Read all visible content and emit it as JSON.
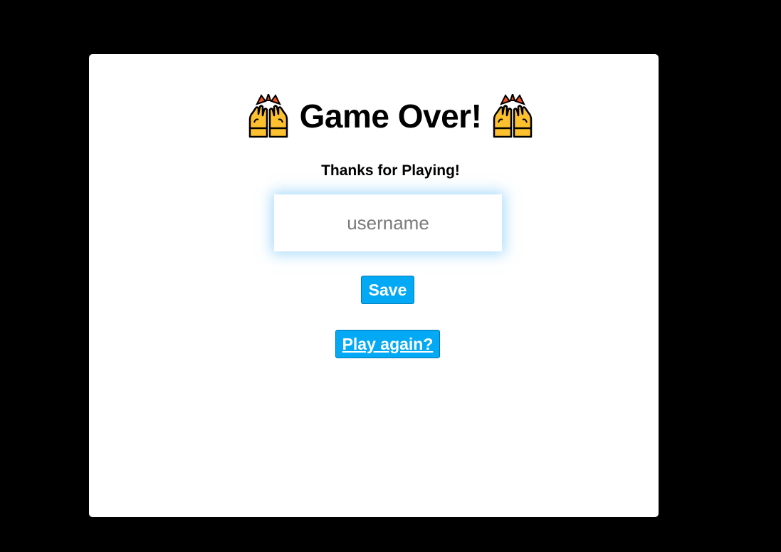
{
  "gameover": {
    "title": "Game Over!",
    "left_icon": "raising-hands-icon",
    "right_icon": "raising-hands-icon",
    "subtitle": "Thanks for Playing!",
    "username_placeholder": "username",
    "username_value": "",
    "save_label": "Save",
    "play_again_label": "Play again?"
  },
  "colors": {
    "background": "#000000",
    "card": "#ffffff",
    "button": "#03a9f4",
    "input_glow": "#64bef5"
  }
}
